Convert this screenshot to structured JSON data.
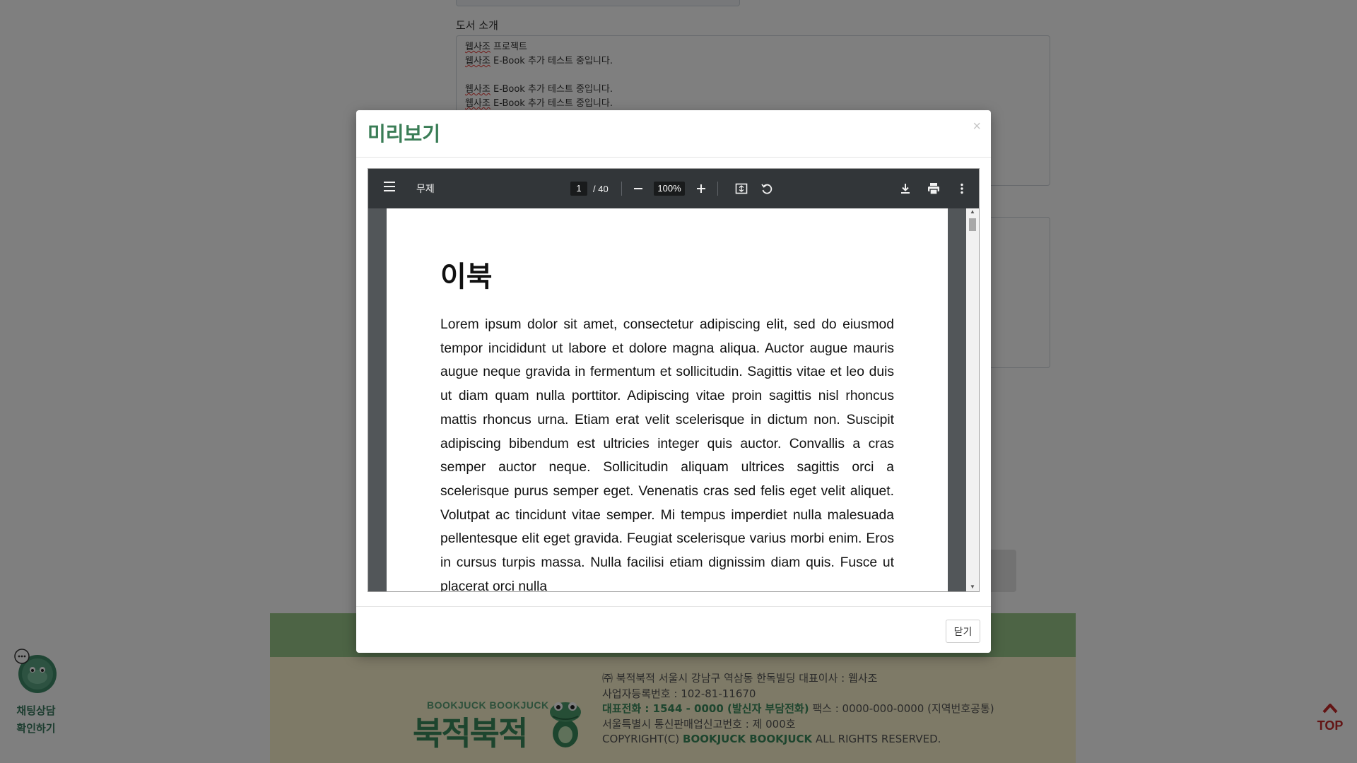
{
  "background": {
    "section_label": "도서 소개",
    "description_lines": [
      {
        "marked": "웹사조",
        "rest": " 프로젝트"
      },
      {
        "marked": "웹사조",
        "rest": " E-Book 추가 테스트 중입니다."
      },
      {
        "marked": "",
        "rest": ""
      },
      {
        "marked": "웹사조",
        "rest": " E-Book 추가 테스트 중입니다."
      },
      {
        "marked": "웹사조",
        "rest": " E-Book 추가 테스트 중입니다."
      }
    ]
  },
  "modal": {
    "title": "미리보기",
    "close_symbol": "×",
    "close_button": "닫기"
  },
  "viewer": {
    "doc_title": "무제",
    "current_page": "1",
    "total_pages": "/ 40",
    "zoom": "100%",
    "icons": {
      "menu": "menu-icon",
      "zoom_out": "minus-icon",
      "zoom_in": "plus-icon",
      "fit": "fit-page-icon",
      "rotate": "rotate-icon",
      "download": "download-icon",
      "print": "print-icon",
      "more": "more-vertical-icon"
    }
  },
  "document": {
    "heading": "이북",
    "paragraph": "Lorem ipsum dolor sit amet, consectetur adipiscing elit, sed do eiusmod tempor incididunt ut labore et dolore magna aliqua. Auctor augue mauris augue neque gravida in fermentum et sollicitudin. Sagittis vitae et leo duis ut diam quam nulla porttitor. Adipiscing vitae proin sagittis nisl rhoncus mattis rhoncus urna. Etiam erat velit scelerisque in dictum non. Suscipit adipiscing bibendum est ultricies integer quis auctor. Convallis a cras semper auctor neque. Sollicitudin aliquam ultrices sagittis orci a scelerisque purus semper eget. Venenatis cras sed felis eget velit aliquet. Volutpat ac tincidunt vitae semper. Mi tempus imperdiet nulla malesuada pellentesque elit eget gravida. Feugiat scelerisque varius morbi enim. Eros in cursus turpis massa. Nulla facilisi etiam dignissim diam quis. Fusce ut placerat orci nulla"
  },
  "footer": {
    "logo_small": "BOOKJUCK BOOKJUCK",
    "logo_big": "북적북적",
    "line1": "㈜ 북적북적   서울시 강남구 역삼동 한독빌딩   대표이사 : 웹사조",
    "line2": "사업자등록번호 : 102-81-11670",
    "phone_label": "대표전화 : 1544 - 0000 (발신자 부담전화)",
    "fax": "   팩스 : 0000-000-0000 (지역번호공통)",
    "line4": "서울특별시 통신판매업신고번호 : 제 000호",
    "copyright_prefix": "COPYRIGHT(C) ",
    "copyright_brand": "BOOKJUCK BOOKJUCK",
    "copyright_suffix": " ALL RIGHTS RESERVED."
  },
  "chat_widget": {
    "line1": "채팅상담",
    "line2": "확인하기"
  },
  "top_button": {
    "label": "TOP"
  },
  "colors": {
    "brand_green": "#3a7d56",
    "footer_band": "#9bc88a",
    "footer_bg": "#fdf5cf",
    "top_red": "#c62828",
    "viewer_toolbar": "#323639"
  }
}
